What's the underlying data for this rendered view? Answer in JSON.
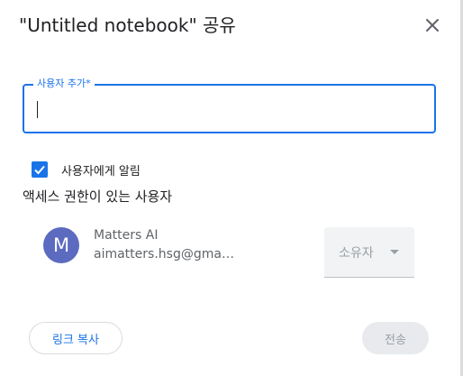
{
  "dialog": {
    "title": "\"Untitled notebook\" 공유",
    "close_icon": "close-icon"
  },
  "add_people": {
    "label": "사용자 추가*",
    "value": "",
    "placeholder": ""
  },
  "notify": {
    "checked": true,
    "label": "사용자에게 알림"
  },
  "access": {
    "section_title": "액세스 권한이 있는 사용자",
    "users": [
      {
        "avatar_letter": "M",
        "avatar_color": "#5c6bc0",
        "name": "Matters AI",
        "email": "aimatters.hsg@gmail.c...",
        "role": "소유자"
      }
    ]
  },
  "footer": {
    "copy_link_label": "링크 복사",
    "send_label": "전송"
  },
  "colors": {
    "accent": "#1a73e8",
    "disabled_text": "#9aa0a6",
    "disabled_bg": "#e8eaed"
  }
}
